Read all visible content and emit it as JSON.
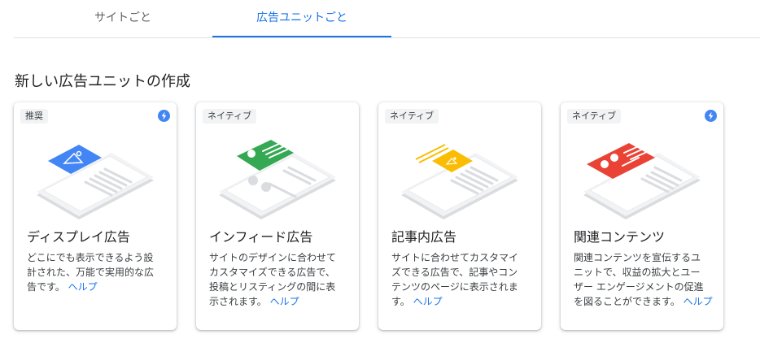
{
  "tabs": [
    {
      "label": "サイトごと",
      "active": false
    },
    {
      "label": "広告ユニットごと",
      "active": true
    }
  ],
  "section_title": "新しい広告ユニットの作成",
  "colors": {
    "accent": "#1a73e8",
    "display_ad": "#4285f4",
    "infeed_ad": "#34a853",
    "inarticle_ad": "#fbbc04",
    "related_content": "#ea4335"
  },
  "cards": [
    {
      "badge": "推奨",
      "lightning_icon": true,
      "title": "ディスプレイ広告",
      "desc_line1": "どこにでも表示できるよう設",
      "desc_line2": "計された、万能で実用的な広",
      "desc_line3": "告です。",
      "help": "ヘルプ",
      "icon": "display-ad-illustration"
    },
    {
      "badge": "ネイティブ",
      "lightning_icon": false,
      "title": "インフィード広告",
      "desc_line1": "サイトのデザインに合わせて",
      "desc_line2": "カスタマイズできる広告で、",
      "desc_line3": "投稿とリスティングの間に表",
      "desc_line4": "示されます。",
      "help": "ヘルプ",
      "icon": "infeed-ad-illustration"
    },
    {
      "badge": "ネイティブ",
      "lightning_icon": false,
      "title": "記事内広告",
      "desc_line1": "サイトに合わせてカスタマイ",
      "desc_line2": "ズできる広告で、記事やコン",
      "desc_line3": "テンツのページに表示されま",
      "desc_line4": "す。",
      "help": "ヘルプ",
      "icon": "inarticle-ad-illustration"
    },
    {
      "badge": "ネイティブ",
      "lightning_icon": true,
      "title": "関連コンテンツ",
      "desc_line1": "関連コンテンツを宣伝するユ",
      "desc_line2": "ニットで、収益の拡大とユー",
      "desc_line3": "ザー エンゲージメントの促進",
      "desc_line4": "を図ることができます。",
      "help": "ヘルプ",
      "icon": "related-content-illustration"
    }
  ]
}
